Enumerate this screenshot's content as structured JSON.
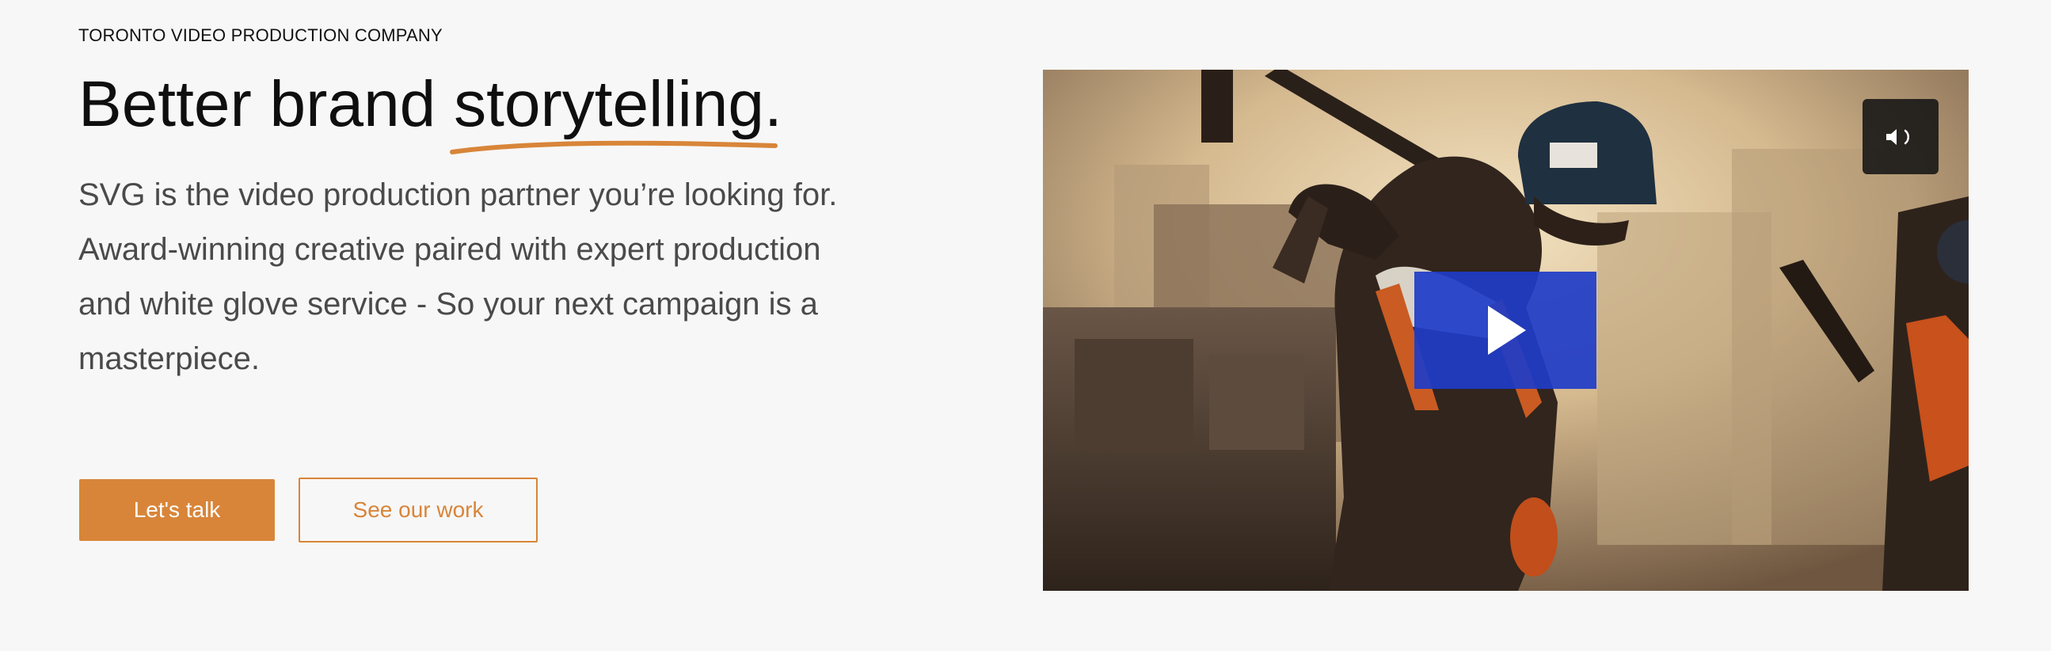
{
  "hero": {
    "eyebrow": "TORONTO VIDEO PRODUCTION COMPANY",
    "headline_start": "Better brand ",
    "headline_accent": "storytelling",
    "headline_end": ".",
    "description": "SVG is the video production partner you’re looking for. Award-winning creative paired with expert production and white glove service - So your next campaign is a masterpiece."
  },
  "buttons": {
    "primary": "Let's talk",
    "secondary": "See our work"
  },
  "video": {
    "play_icon": "play-icon",
    "mute_icon": "volume-icon"
  },
  "colors": {
    "accent": "#d88539",
    "play": "#1e3cc8",
    "background": "#f7f7f7"
  }
}
